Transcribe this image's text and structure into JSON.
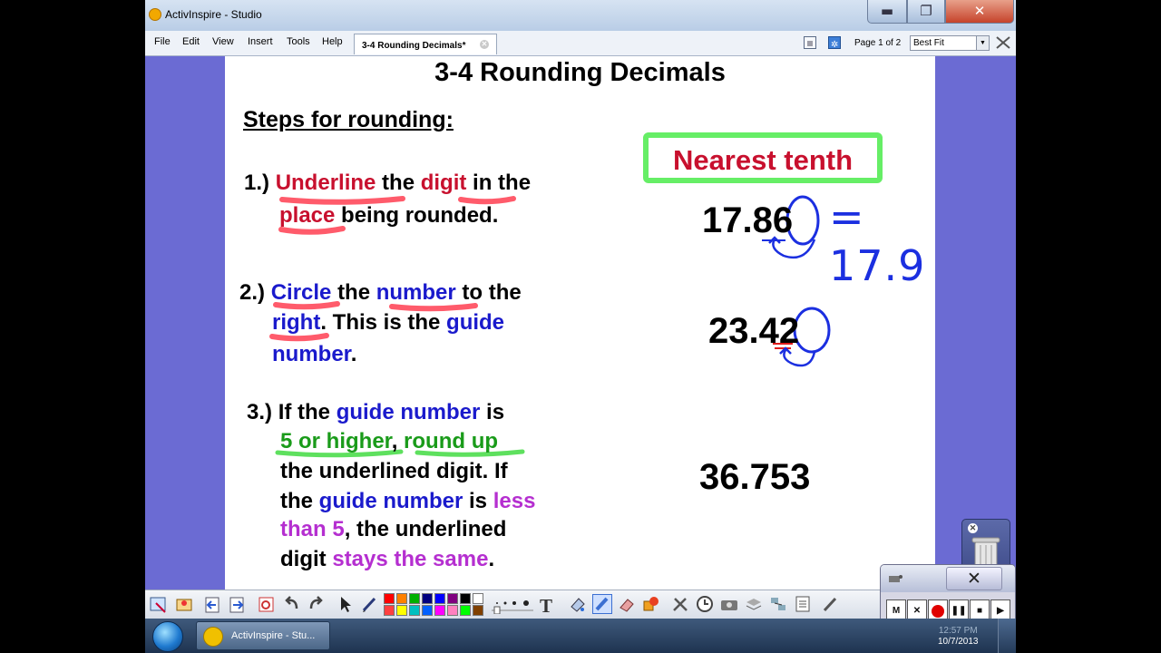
{
  "window": {
    "title": "ActivInspire - Studio",
    "min_label": "▬",
    "max_label": "❐",
    "close_label": "✕"
  },
  "menu": [
    "File",
    "Edit",
    "View",
    "Insert",
    "Tools",
    "Help"
  ],
  "doc_tab": {
    "label": "3-4 Rounding Decimals*",
    "close_label": "✕"
  },
  "page_indicator": "Page 1 of 2",
  "zoom": {
    "value": "Best Fit",
    "arrow": "▼"
  },
  "flipchart": {
    "title": "3-4 Rounding Decimals",
    "steps_heading": "Steps for rounding:",
    "step1": {
      "num": "1.)",
      "w1": "Underline",
      "w2": "the",
      "w3": "digit",
      "w4": "in the",
      "w5": "place",
      "w6": "being rounded."
    },
    "step2": {
      "num": "2.)",
      "w1": "Circle",
      "w2": "the",
      "w3": "number",
      "w4": "to the",
      "w5": "right",
      "w6": ".  This is the",
      "w7": "guide",
      "w8": "number",
      "w9": "."
    },
    "step3": {
      "num": "3.)",
      "w1": "If the",
      "w2": "guide number",
      "w3": "is",
      "w4": "5 or higher",
      "w5": ",",
      "w6": "round up",
      "line3": "the underlined digit. If",
      "w7": "the",
      "w8": "guide number",
      "w9": "is",
      "w10": "less",
      "w11": "than 5",
      "w12": ", the underlined",
      "w13": "digit",
      "w14": "stays the same",
      "w15": "."
    },
    "nearest_label": "Nearest tenth",
    "examples": [
      "17.86",
      "23.42",
      "36.753"
    ],
    "handwritten_answer": "= 17.9"
  },
  "toolbox": {
    "text_tool": "T"
  },
  "palette_colors": [
    "#ff0000",
    "#ff8000",
    "#00b000",
    "#000080",
    "#0000ff",
    "#800080",
    "#000000",
    "#ffffff",
    "#ff4040",
    "#ffff00",
    "#00c0c0",
    "#0060ff",
    "#ff00ff",
    "#ff80c0",
    "#00ff00",
    "#804000"
  ],
  "taskbar": {
    "app_label": "ActivInspire - Stu...",
    "time": "12:57 PM",
    "date": "10/7/2013"
  },
  "recorder": {
    "close_label": "✕",
    "buttons": [
      "M",
      "✕",
      "",
      "❚❚",
      "■",
      "▶"
    ]
  },
  "colors": {
    "red": "#c8102e",
    "blue": "#1a1acc",
    "green_text": "#1a9b1a",
    "purple": "#b52fd0",
    "box_green": "#66ee66",
    "ink_blue": "#1b2fe0",
    "background": "#6b6bd3"
  }
}
